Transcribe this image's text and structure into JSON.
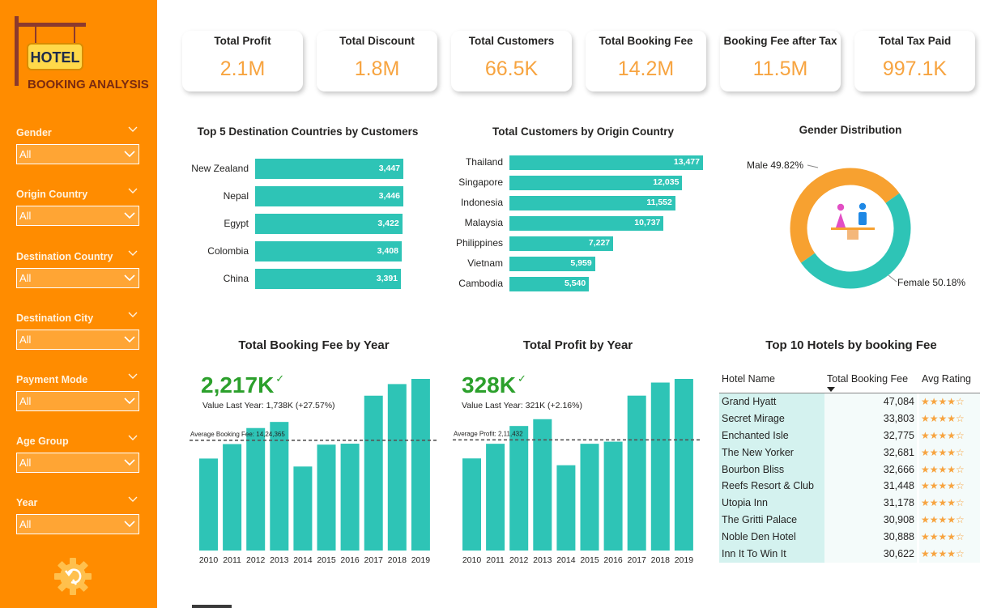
{
  "sidebar": {
    "logo_sign": "HOTEL",
    "logo_sub": "BOOKING ANALYSIS",
    "filters": [
      {
        "label": "Gender",
        "value": "All"
      },
      {
        "label": "Origin Country",
        "value": "All"
      },
      {
        "label": "Destination Country",
        "value": "All"
      },
      {
        "label": "Destination City",
        "value": "All"
      },
      {
        "label": "Payment Mode",
        "value": "All"
      },
      {
        "label": "Age Group",
        "value": "All"
      },
      {
        "label": "Year",
        "value": "All"
      }
    ]
  },
  "kpis": [
    {
      "title": "Total Profit",
      "value": "2.1M"
    },
    {
      "title": "Total Discount",
      "value": "1.8M"
    },
    {
      "title": "Total Customers",
      "value": "66.5K"
    },
    {
      "title": "Total Booking Fee",
      "value": "14.2M"
    },
    {
      "title": "Booking Fee after Tax",
      "value": "11.5M"
    },
    {
      "title": "Total Tax Paid",
      "value": "997.1K"
    }
  ],
  "colors": {
    "accent": "#FF8C00",
    "bar": "#2EC4B6",
    "kpi_value": "#F7A440",
    "good": "#2CA02C"
  },
  "dest": {
    "title": "Top 5 Destination Countries by Customers",
    "chart_data": {
      "type": "bar",
      "orientation": "horizontal",
      "categories": [
        "New Zealand",
        "Nepal",
        "Egypt",
        "Colombia",
        "China"
      ],
      "values": [
        3447,
        3446,
        3422,
        3408,
        3391
      ],
      "labels": [
        "3,447",
        "3,446",
        "3,422",
        "3,408",
        "3,391"
      ]
    }
  },
  "origin": {
    "title": "Total Customers by Origin Country",
    "chart_data": {
      "type": "bar",
      "orientation": "horizontal",
      "categories": [
        "Thailand",
        "Singapore",
        "Indonesia",
        "Malaysia",
        "Philippines",
        "Vietnam",
        "Cambodia"
      ],
      "values": [
        13477,
        12035,
        11552,
        10737,
        7227,
        5959,
        5540
      ],
      "labels": [
        "13,477",
        "12,035",
        "11,552",
        "10,737",
        "7,227",
        "5,959",
        "5,540"
      ]
    }
  },
  "gender": {
    "title": "Gender Distribution",
    "chart_data": {
      "type": "pie",
      "donut": true,
      "categories": [
        "Male",
        "Female"
      ],
      "values": [
        49.82,
        50.18
      ],
      "labels": [
        "Male 49.82%",
        "Female 50.18%"
      ],
      "colors": [
        "#F7A130",
        "#2EC4B6"
      ]
    }
  },
  "fee_year": {
    "title": "Total Booking Fee by Year",
    "big_value": "2,217K",
    "sub": "Value Last Year: 1,738K (+27.57%)",
    "avg_label": "Average Booking Fee: 14,24,365",
    "chart_data": {
      "type": "bar",
      "categories": [
        "2010",
        "2011",
        "2012",
        "2013",
        "2014",
        "2015",
        "2016",
        "2017",
        "2018",
        "2019"
      ],
      "values": [
        1188,
        1375,
        1582,
        1661,
        1085,
        1368,
        1380,
        2000,
        2150,
        2217
      ],
      "average": 1424.365,
      "ylim": [
        0,
        2217
      ]
    }
  },
  "profit_year": {
    "title": "Total Profit by Year",
    "big_value": "328K",
    "sub": "Value Last Year: 321K (+2.16%)",
    "avg_label": "Average Profit: 2,11,432",
    "chart_data": {
      "type": "bar",
      "categories": [
        "2010",
        "2011",
        "2012",
        "2013",
        "2014",
        "2015",
        "2016",
        "2017",
        "2018",
        "2019"
      ],
      "values": [
        176,
        204,
        238,
        251,
        163,
        204,
        208,
        296,
        321,
        328
      ],
      "average": 211.432,
      "ylim": [
        0,
        328
      ]
    }
  },
  "hotels": {
    "title": "Top 10 Hotels by booking Fee",
    "columns": [
      "Hotel Name",
      "Total Booking Fee",
      "Avg Rating"
    ],
    "rows": [
      {
        "name": "Grand Hyatt",
        "fee": "47,084",
        "stars": "★★★★☆"
      },
      {
        "name": "Secret Mirage",
        "fee": "33,803",
        "stars": "★★★★☆"
      },
      {
        "name": "Enchanted Isle",
        "fee": "32,775",
        "stars": "★★★★☆"
      },
      {
        "name": "The New Yorker",
        "fee": "32,681",
        "stars": "★★★★☆"
      },
      {
        "name": "Bourbon Bliss",
        "fee": "32,666",
        "stars": "★★★★☆"
      },
      {
        "name": "Reefs Resort & Club",
        "fee": "31,448",
        "stars": "★★★★☆"
      },
      {
        "name": "Utopia Inn",
        "fee": "31,178",
        "stars": "★★★★☆"
      },
      {
        "name": "The Gritti Palace",
        "fee": "30,908",
        "stars": "★★★★☆"
      },
      {
        "name": "Noble Den Hotel",
        "fee": "30,888",
        "stars": "★★★★☆"
      },
      {
        "name": "Inn It To Win It",
        "fee": "30,622",
        "stars": "★★★★☆"
      }
    ]
  }
}
